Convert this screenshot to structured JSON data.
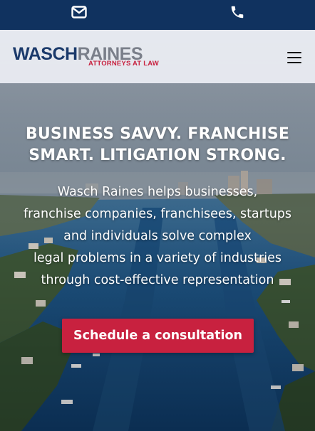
{
  "topbar": {
    "mail_icon": "envelope-icon",
    "phone_icon": "phone-icon"
  },
  "header": {
    "logo_word_1": "WASCH",
    "logo_word_2": "RAINES",
    "logo_tagline": "ATTORNEYS AT LAW",
    "menu_icon": "hamburger-menu-icon"
  },
  "hero": {
    "title_line_1": "BUSINESS SAVVY. FRANCHISE",
    "title_line_2": "SMART. LITIGATION STRONG.",
    "text_line_1": "Wasch Raines helps businesses,",
    "text_line_2": "franchise companies, franchisees, startups",
    "text_line_3": "and individuals solve complex",
    "text_line_4": "legal problems in a variety of industries",
    "text_line_5": "through cost-effective representation",
    "cta_label": "Schedule a consultation"
  },
  "colors": {
    "topbar_bg": "#10325f",
    "brand_navy": "#1b3a6b",
    "brand_gray": "#7a7f8a",
    "accent_red": "#c8213f",
    "header_bg": "#eceef4"
  }
}
